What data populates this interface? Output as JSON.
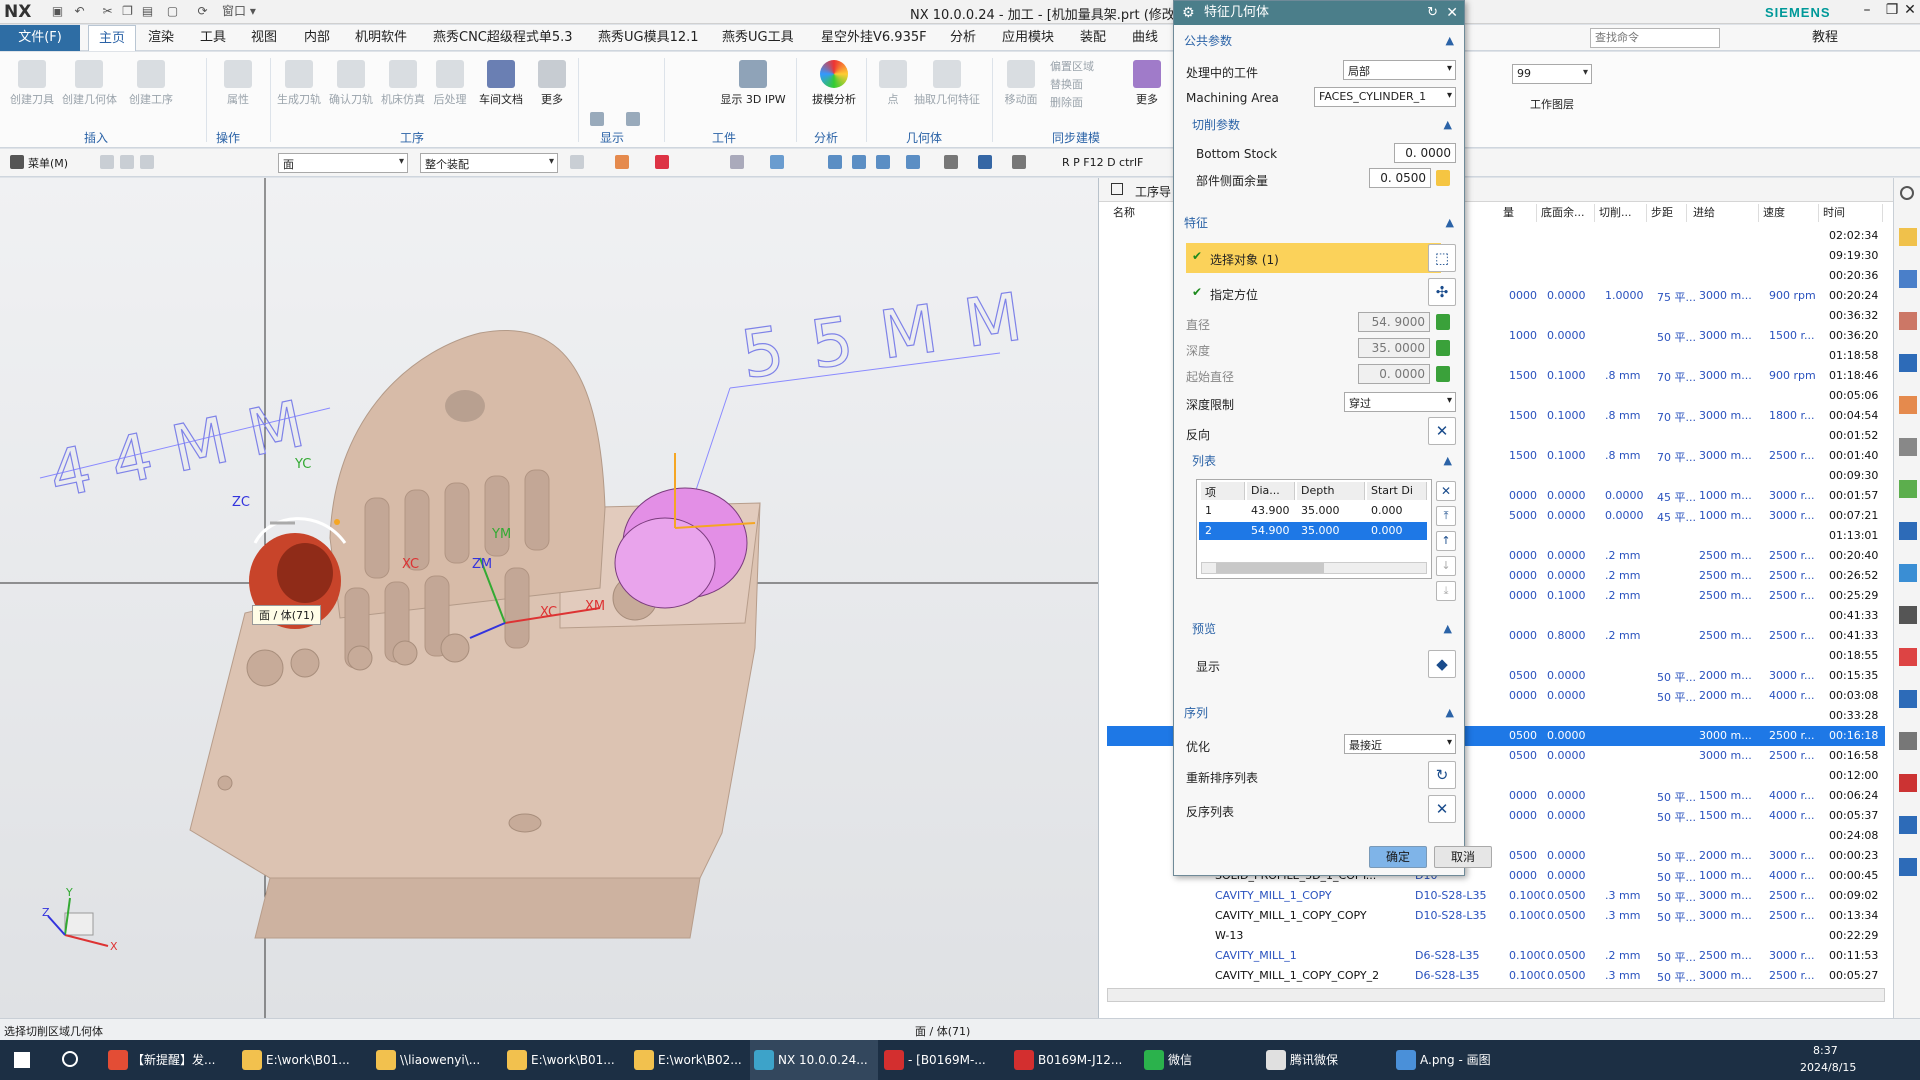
{
  "app": {
    "logo": "NX",
    "title": "NX 10.0.0.24 - 加工 - [机加量具架.prt  (修改的",
    "brand": "SIEMENS",
    "window_menu": "窗口"
  },
  "menu": {
    "file": "文件(F)",
    "tabs": [
      "主页",
      "渲染",
      "工具",
      "视图",
      "内部",
      "机明软件",
      "燕秀CNC超级程式单5.3",
      "燕秀UG模具12.1",
      "燕秀UG工具",
      "星空外挂V6.935F",
      "分析",
      "应用模块",
      "装配",
      "曲线"
    ],
    "search_placeholder": "查找命令",
    "tutorial": "教程"
  },
  "ribbon": {
    "buttons": [
      "创建刀具",
      "创建几何体",
      "创建工序",
      "属性",
      "生成刀轨",
      "确认刀轨",
      "机床仿真",
      "后处理",
      "车间文档",
      "更多",
      "显示 3D IPW",
      "拔模分析",
      "点",
      "抽取几何特征",
      "移动面",
      "偏置区域",
      "替换面",
      "删除面",
      "更多"
    ],
    "groups": [
      "插入",
      "操作",
      "工序",
      "显示",
      "工件",
      "分析",
      "几何体",
      "同步建模"
    ],
    "layer_value": "99",
    "layer_label": "工作图层"
  },
  "toolbar2": {
    "menu": "菜单(M)",
    "filter1": "面",
    "filter2": "整个装配",
    "keys": "R  P  F12  D  ctrlF"
  },
  "viewport": {
    "dim1": "44MM",
    "dim2": "55MM",
    "tooltip": "面 / 体(71)",
    "axes": {
      "xc": "XC",
      "yc": "YC",
      "zc": "ZC",
      "xm": "XM",
      "ym": "YM",
      "zm": "ZM"
    },
    "triad": {
      "x": "X",
      "y": "Y",
      "z": "Z"
    }
  },
  "navigator": {
    "title": "工序导",
    "columns": [
      "名称",
      "量",
      "底面余...",
      "切削...",
      "步距",
      "进给",
      "速度",
      "时间"
    ],
    "rows": [
      {
        "name": "",
        "c1": "",
        "c2": "",
        "c3": "",
        "c4": "",
        "c5": "",
        "c6": "",
        "time": "02:02:34"
      },
      {
        "name": "",
        "c1": "",
        "c2": "",
        "c3": "",
        "c4": "",
        "c5": "",
        "c6": "",
        "time": "09:19:30"
      },
      {
        "name": "",
        "c1": "",
        "c2": "",
        "c3": "",
        "c4": "",
        "c5": "",
        "c6": "",
        "time": "00:20:36"
      },
      {
        "name": "",
        "c1": "0000",
        "c2": "0.0000",
        "c3": "1.0000",
        "c4": "75 平...",
        "c5": "3000 m...",
        "c6": "900 rpm",
        "time": "00:20:24"
      },
      {
        "name": "",
        "c1": "",
        "c2": "",
        "c3": "",
        "c4": "",
        "c5": "",
        "c6": "",
        "time": "00:36:32"
      },
      {
        "name": "",
        "c1": "1000",
        "c2": "0.0000",
        "c3": "",
        "c4": "50 平...",
        "c5": "3000 m...",
        "c6": "1500 r...",
        "time": "00:36:20"
      },
      {
        "name": "",
        "c1": "",
        "c2": "",
        "c3": "",
        "c4": "",
        "c5": "",
        "c6": "",
        "time": "01:18:58"
      },
      {
        "name": "",
        "c1": "1500",
        "c2": "0.1000",
        "c3": ".8 mm",
        "c4": "70 平...",
        "c5": "3000 m...",
        "c6": "900 rpm",
        "time": "01:18:46"
      },
      {
        "name": "",
        "c1": "",
        "c2": "",
        "c3": "",
        "c4": "",
        "c5": "",
        "c6": "",
        "time": "00:05:06"
      },
      {
        "name": "",
        "c1": "1500",
        "c2": "0.1000",
        "c3": ".8 mm",
        "c4": "70 平...",
        "c5": "3000 m...",
        "c6": "1800 r...",
        "time": "00:04:54"
      },
      {
        "name": "",
        "c1": "",
        "c2": "",
        "c3": "",
        "c4": "",
        "c5": "",
        "c6": "",
        "time": "00:01:52"
      },
      {
        "name": "",
        "c1": "1500",
        "c2": "0.1000",
        "c3": ".8 mm",
        "c4": "70 平...",
        "c5": "3000 m...",
        "c6": "2500 r...",
        "time": "00:01:40"
      },
      {
        "name": "",
        "c1": "",
        "c2": "",
        "c3": "",
        "c4": "",
        "c5": "",
        "c6": "",
        "time": "00:09:30"
      },
      {
        "name": "",
        "c1": "0000",
        "c2": "0.0000",
        "c3": "0.0000",
        "c4": "45 平...",
        "c5": "1000 m...",
        "c6": "3000 r...",
        "time": "00:01:57"
      },
      {
        "name": "",
        "c1": "5000",
        "c2": "0.0000",
        "c3": "0.0000",
        "c4": "45 平...",
        "c5": "1000 m...",
        "c6": "3000 r...",
        "time": "00:07:21"
      },
      {
        "name": "",
        "c1": "",
        "c2": "",
        "c3": "",
        "c4": "",
        "c5": "",
        "c6": "",
        "time": "01:13:01"
      },
      {
        "name": "",
        "c1": "0000",
        "c2": "0.0000",
        "c3": ".2 mm",
        "c4": "",
        "c5": "2500 m...",
        "c6": "2500 r...",
        "time": "00:20:40"
      },
      {
        "name": "",
        "c1": "0000",
        "c2": "0.0000",
        "c3": ".2 mm",
        "c4": "",
        "c5": "2500 m...",
        "c6": "2500 r...",
        "time": "00:26:52"
      },
      {
        "name": "",
        "c1": "0000",
        "c2": "0.1000",
        "c3": ".2 mm",
        "c4": "",
        "c5": "2500 m...",
        "c6": "2500 r...",
        "time": "00:25:29"
      },
      {
        "name": "",
        "c1": "",
        "c2": "",
        "c3": "",
        "c4": "",
        "c5": "",
        "c6": "",
        "time": "00:41:33"
      },
      {
        "name": "",
        "c1": "0000",
        "c2": "0.8000",
        "c3": ".2 mm",
        "c4": "",
        "c5": "2500 m...",
        "c6": "2500 r...",
        "time": "00:41:33"
      },
      {
        "name": "",
        "c1": "",
        "c2": "",
        "c3": "",
        "c4": "",
        "c5": "",
        "c6": "",
        "time": "00:18:55"
      },
      {
        "name": "",
        "c1": "0500",
        "c2": "0.0000",
        "c3": "",
        "c4": "50 平...",
        "c5": "2000 m...",
        "c6": "3000 r...",
        "time": "00:15:35"
      },
      {
        "name": "",
        "c1": "0000",
        "c2": "0.0000",
        "c3": "",
        "c4": "50 平...",
        "c5": "2000 m...",
        "c6": "4000 r...",
        "time": "00:03:08"
      },
      {
        "name": "",
        "c1": "",
        "c2": "",
        "c3": "",
        "c4": "",
        "c5": "",
        "c6": "",
        "time": "00:33:28"
      },
      {
        "name": "",
        "c1": "0500",
        "c2": "0.0000",
        "c3": "",
        "c4": "",
        "c5": "3000 m...",
        "c6": "2500 r...",
        "time": "00:16:18",
        "sel": true
      },
      {
        "name": "",
        "c1": "0500",
        "c2": "0.0000",
        "c3": "",
        "c4": "",
        "c5": "3000 m...",
        "c6": "2500 r...",
        "time": "00:16:58"
      },
      {
        "name": "",
        "c1": "",
        "c2": "",
        "c3": "",
        "c4": "",
        "c5": "",
        "c6": "",
        "time": "00:12:00"
      },
      {
        "name": "",
        "c1": "0000",
        "c2": "0.0000",
        "c3": "",
        "c4": "50 平...",
        "c5": "1500 m...",
        "c6": "4000 r...",
        "time": "00:06:24"
      },
      {
        "name": "",
        "c1": "0000",
        "c2": "0.0000",
        "c3": "",
        "c4": "50 平...",
        "c5": "1500 m...",
        "c6": "4000 r...",
        "time": "00:05:37"
      },
      {
        "name": "",
        "c1": "",
        "c2": "",
        "c3": "",
        "c4": "",
        "c5": "",
        "c6": "",
        "time": "00:24:08"
      },
      {
        "name": "",
        "c1": "0500",
        "c2": "0.0000",
        "c3": "",
        "c4": "50 平...",
        "c5": "2000 m...",
        "c6": "3000 r...",
        "time": "00:00:23"
      },
      {
        "name": "SOLID_PROFILE_3D_1_COPY...",
        "tool": "D10",
        "c1": "0000",
        "c2": "0.0000",
        "c3": "",
        "c4": "50 平...",
        "c5": "1000 m...",
        "c6": "4000 r...",
        "time": "00:00:45",
        "blue": false
      },
      {
        "name": "CAVITY_MILL_1_COPY",
        "tool": "D10-S28-L35",
        "c1": "0.1000",
        "c2": "0.0500",
        "c3": ".3 mm",
        "c4": "50 平...",
        "c5": "3000 m...",
        "c6": "2500 r...",
        "time": "00:09:02",
        "blue": true
      },
      {
        "name": "CAVITY_MILL_1_COPY_COPY",
        "tool": "D10-S28-L35",
        "c1": "0.1000",
        "c2": "0.0500",
        "c3": ".3 mm",
        "c4": "50 平...",
        "c5": "3000 m...",
        "c6": "2500 r...",
        "time": "00:13:34",
        "blue": false
      },
      {
        "name": "W-13",
        "tool": "",
        "c1": "",
        "c2": "",
        "c3": "",
        "c4": "",
        "c5": "",
        "c6": "",
        "time": "00:22:29",
        "blue": false
      },
      {
        "name": "CAVITY_MILL_1",
        "tool": "D6-S28-L35",
        "c1": "0.1000",
        "c2": "0.0500",
        "c3": ".2 mm",
        "c4": "50 平...",
        "c5": "2500 m...",
        "c6": "3000 r...",
        "time": "00:11:53",
        "blue": true
      },
      {
        "name": "CAVITY_MILL_1_COPY_COPY_2",
        "tool": "D6-S28-L35",
        "c1": "0.1000",
        "c2": "0.0500",
        "c3": ".3 mm",
        "c4": "50 平...",
        "c5": "3000 m...",
        "c6": "2500 r...",
        "time": "00:05:27",
        "blue": false
      }
    ]
  },
  "dialog": {
    "title": "特征几何体",
    "sec_common": "公共参数",
    "lbl_workpiece": "处理中的工件",
    "val_workpiece": "局部",
    "lbl_machining_area": "Machining Area",
    "val_machining_area": "FACES_CYLINDER_1",
    "sec_cut": "切削参数",
    "lbl_bottom_stock": "Bottom Stock",
    "val_bottom_stock": "0. 0000",
    "lbl_side_stock": "部件侧面余量",
    "val_side_stock": "0. 0500",
    "sec_feature": "特征",
    "lbl_select": "选择对象 (1)",
    "lbl_orient": "指定方位",
    "lbl_diameter": "直径",
    "val_diameter": "54. 9000",
    "lbl_depth": "深度",
    "val_depth": "35. 0000",
    "lbl_start_dia": "起始直径",
    "val_start_dia": "0. 0000",
    "lbl_depth_limit": "深度限制",
    "val_depth_limit": "穿过",
    "lbl_reverse": "反向",
    "sec_list": "列表",
    "table_cols": [
      "项",
      "Dia...",
      "Depth",
      "Start Di"
    ],
    "table_rows": [
      [
        "1",
        "43.900",
        "35.000",
        "0.000"
      ],
      [
        "2",
        "54.900",
        "35.000",
        "0.000"
      ]
    ],
    "sec_preview": "预览",
    "lbl_show": "显示",
    "sec_sequence": "序列",
    "lbl_optimize": "优化",
    "val_optimize": "最接近",
    "lbl_reorder": "重新排序列表",
    "lbl_reverse_list": "反序列表",
    "ok": "确定",
    "cancel": "取消"
  },
  "status": {
    "left": "选择切削区域几何体",
    "center": "面 / 体(71)"
  },
  "taskbar": {
    "apps": [
      "【新提醒】发...",
      "E:\\work\\B01...",
      "\\\\liaowenyi\\...",
      "E:\\work\\B01...",
      "E:\\work\\B02...",
      "NX 10.0.0.24...",
      "- [B0169M-...",
      "B0169M-J12...",
      "微信",
      "腾讯微保",
      "A.png - 画图"
    ],
    "time": "8:37",
    "date": "2024/8/15"
  },
  "colors": {
    "accent": "#2e6da4",
    "dialog_title": "#4b7e8a",
    "selection": "#1e78e6",
    "highlight": "#fbd25a",
    "feature_pink": "#e38fe6",
    "feature_red": "#c8442a"
  }
}
